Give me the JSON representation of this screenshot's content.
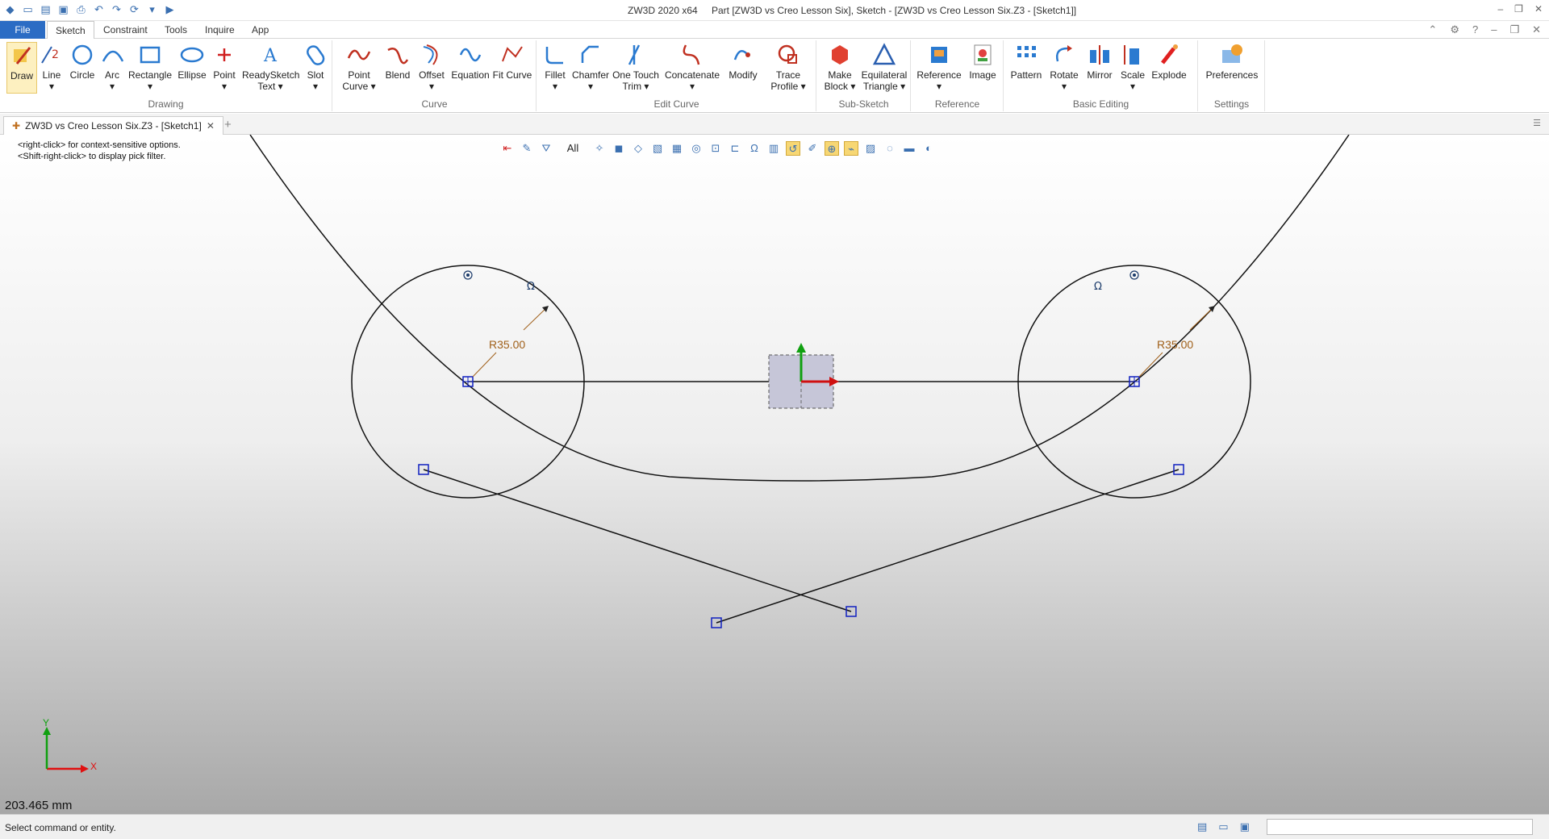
{
  "titlebar": {
    "app_name": "ZW3D 2020 x64",
    "doc_title": "Part [ZW3D vs Creo Lesson Six],  Sketch - [ZW3D vs Creo Lesson Six.Z3 - [Sketch1]]"
  },
  "menu": {
    "file": "File",
    "tabs": [
      "Sketch",
      "Constraint",
      "Tools",
      "Inquire",
      "App"
    ]
  },
  "ribbon": {
    "groups": {
      "drawing": "Drawing",
      "curve": "Curve",
      "edit_curve": "Edit Curve",
      "sub_sketch": "Sub-Sketch",
      "reference": "Reference",
      "basic_editing": "Basic Editing",
      "settings": "Settings"
    },
    "tools": {
      "draw": "Draw",
      "line": "Line",
      "circle": "Circle",
      "arc": "Arc",
      "rectangle": "Rectangle",
      "ellipse": "Ellipse",
      "point": "Point",
      "readysketch_text_1": "ReadySketch",
      "readysketch_text_2": "Text",
      "slot": "Slot",
      "point_curve_1": "Point",
      "point_curve_2": "Curve",
      "blend": "Blend",
      "offset": "Offset",
      "equation": "Equation",
      "fit_curve": "Fit Curve",
      "fillet": "Fillet",
      "chamfer": "Chamfer",
      "one_touch_trim_1": "One Touch",
      "one_touch_trim_2": "Trim",
      "concatenate": "Concatenate",
      "modify": "Modify",
      "trace_profile_1": "Trace",
      "trace_profile_2": "Profile",
      "make_block_1": "Make",
      "make_block_2": "Block",
      "equilateral_triangle_1": "Equilateral",
      "equilateral_triangle_2": "Triangle",
      "reference": "Reference",
      "image": "Image",
      "pattern": "Pattern",
      "rotate": "Rotate",
      "mirror": "Mirror",
      "scale": "Scale",
      "explode": "Explode",
      "preferences": "Preferences"
    }
  },
  "doc_tab": {
    "label": "ZW3D vs Creo Lesson Six.Z3 - [Sketch1]"
  },
  "viewport": {
    "hint_1": "<right-click> for context-sensitive options.",
    "hint_2": "<Shift-right-click> to display pick filter.",
    "filter_value": "All",
    "dim_left": "R35.00",
    "dim_right": "R35.00",
    "axis_x": "X",
    "axis_y": "Y",
    "measure": "203.465 mm"
  },
  "status": {
    "message": "Select command or entity."
  },
  "colors": {
    "accent": "#2b6cc4",
    "dimension": "#a0601a",
    "constraint_point": "#1020c0",
    "axis_x": "#e01010",
    "axis_y": "#10a010"
  }
}
